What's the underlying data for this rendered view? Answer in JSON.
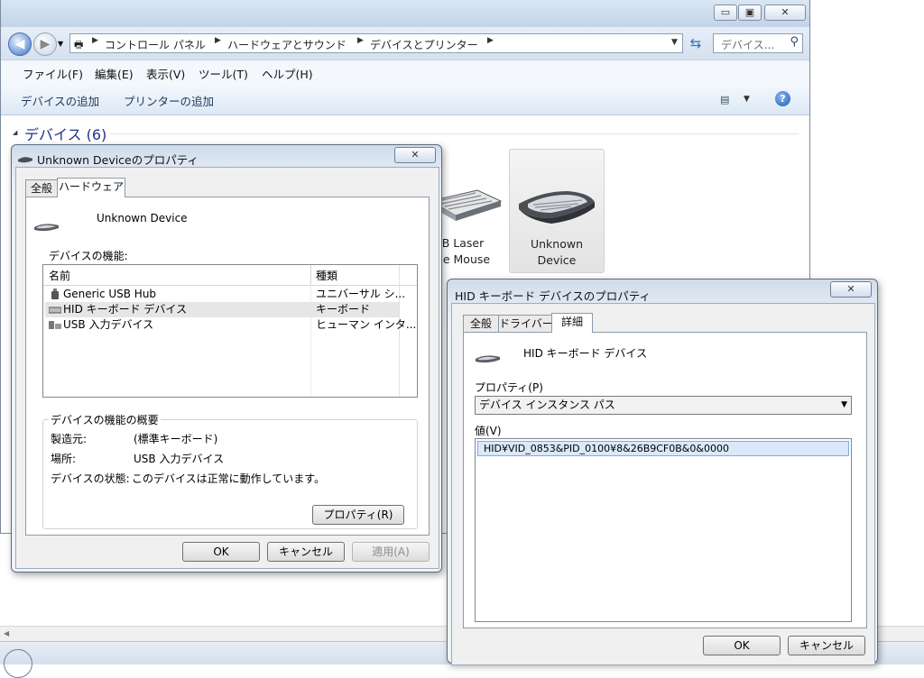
{
  "explorer": {
    "breadcrumbs": [
      "コントロール パネル",
      "ハードウェアとサウンド",
      "デバイスとプリンター"
    ],
    "search_placeholder": "デバイス...",
    "menu": [
      "ファイル(F)",
      "編集(E)",
      "表示(V)",
      "ツール(T)",
      "ヘルプ(H)"
    ],
    "toolbar": [
      "デバイスの追加",
      "プリンターの追加"
    ],
    "group_header": "デバイス (6)",
    "tiles": [
      {
        "label_line1": "B Laser",
        "label_line2": "ne Mouse"
      },
      {
        "label_line1": "Unknown",
        "label_line2": "Device"
      }
    ]
  },
  "dialog1": {
    "title": "Unknown Deviceのプロパティ",
    "tabs": [
      "全般",
      "ハードウェア"
    ],
    "device_name": "Unknown Device",
    "functions_label": "デバイスの機能:",
    "columns": [
      "名前",
      "種類"
    ],
    "rows": [
      {
        "name": "Generic USB Hub",
        "type": "ユニバーサル シ..."
      },
      {
        "name": "HID キーボード デバイス",
        "type": "キーボード"
      },
      {
        "name": "USB 入力デバイス",
        "type": "ヒューマン インタ..."
      }
    ],
    "summary_title": "デバイスの機能の概要",
    "summary": [
      {
        "key": "製造元:",
        "value": "(標準キーボード)"
      },
      {
        "key": "場所:",
        "value": "USB 入力デバイス"
      },
      {
        "key": "デバイスの状態:",
        "value": "このデバイスは正常に動作しています。"
      }
    ],
    "properties_button": "プロパティ(R)",
    "ok": "OK",
    "cancel": "キャンセル",
    "apply": "適用(A)"
  },
  "dialog2": {
    "title": "HID キーボード デバイスのプロパティ",
    "tabs": [
      "全般",
      "ドライバー",
      "詳細"
    ],
    "device_name": "HID キーボード デバイス",
    "property_label": "プロパティ(P)",
    "property_value": "デバイス インスタンス パス",
    "value_label": "値(V)",
    "value": "HID¥VID_0853&PID_0100¥8&26B9CF0B&0&0000",
    "ok": "OK",
    "cancel": "キャンセル"
  }
}
